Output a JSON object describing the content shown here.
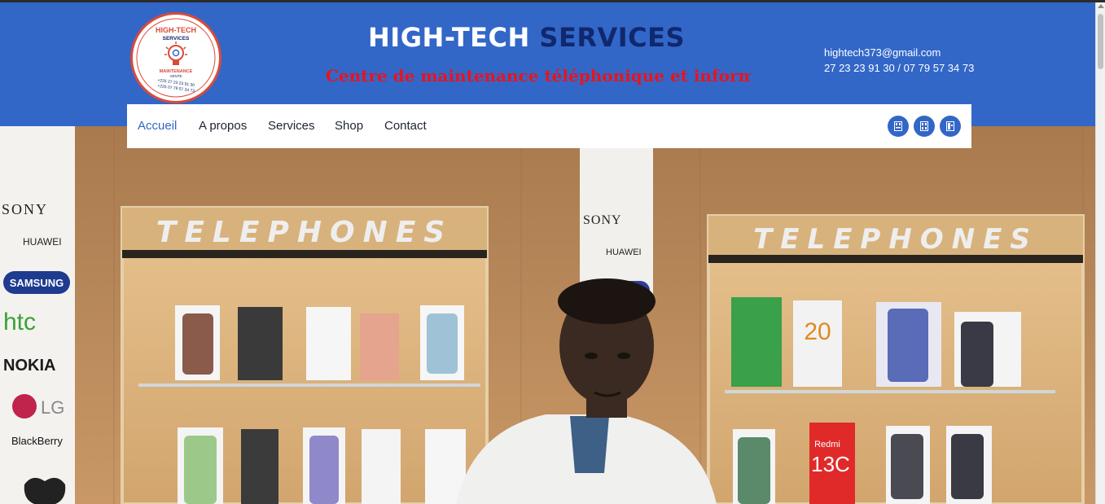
{
  "brand": {
    "title_part1": "HIGH-TECH",
    "title_part2": "SERVICES",
    "tagline": "Centre de maintenance téléphonique et informatique",
    "logo_text_top": "HIGH-TECH",
    "logo_text_services": "SERVICES",
    "logo_text_maintenance": "MAINTENANCE",
    "logo_text_vente": "VENTE",
    "logo_phone1": "+225 27 23 23 91 30",
    "logo_phone2": "+225 07 79 57 34 73"
  },
  "contact": {
    "email": "hightech373@gmail.com",
    "phones": "27 23 23 91 30 / 07 79 57 34 73"
  },
  "nav": {
    "items": [
      {
        "label": "Accueil",
        "active": true
      },
      {
        "label": "A propos",
        "active": false
      },
      {
        "label": "Services",
        "active": false
      },
      {
        "label": "Shop",
        "active": false
      },
      {
        "label": "Contact",
        "active": false
      }
    ],
    "social_icons": [
      "social-icon-1",
      "social-icon-2",
      "social-icon-3"
    ]
  },
  "hero": {
    "banner_brands": [
      "SONY",
      "HUAWEI",
      "SAMSUNG",
      "htc",
      "NOKIA",
      "LG",
      "BlackBerry"
    ],
    "center_banner_brands": [
      "SONY",
      "HUAWEI"
    ],
    "shelf_sign_left": "TELEPHONES",
    "shelf_sign_right": "TELEPHONES",
    "box_label_20": "20",
    "box_label_13c": "13C",
    "box_label_redmi": "Redmi"
  },
  "colors": {
    "header_blue": "#3267c8",
    "title_dark": "#10286e",
    "tagline_red": "#e8141e"
  }
}
